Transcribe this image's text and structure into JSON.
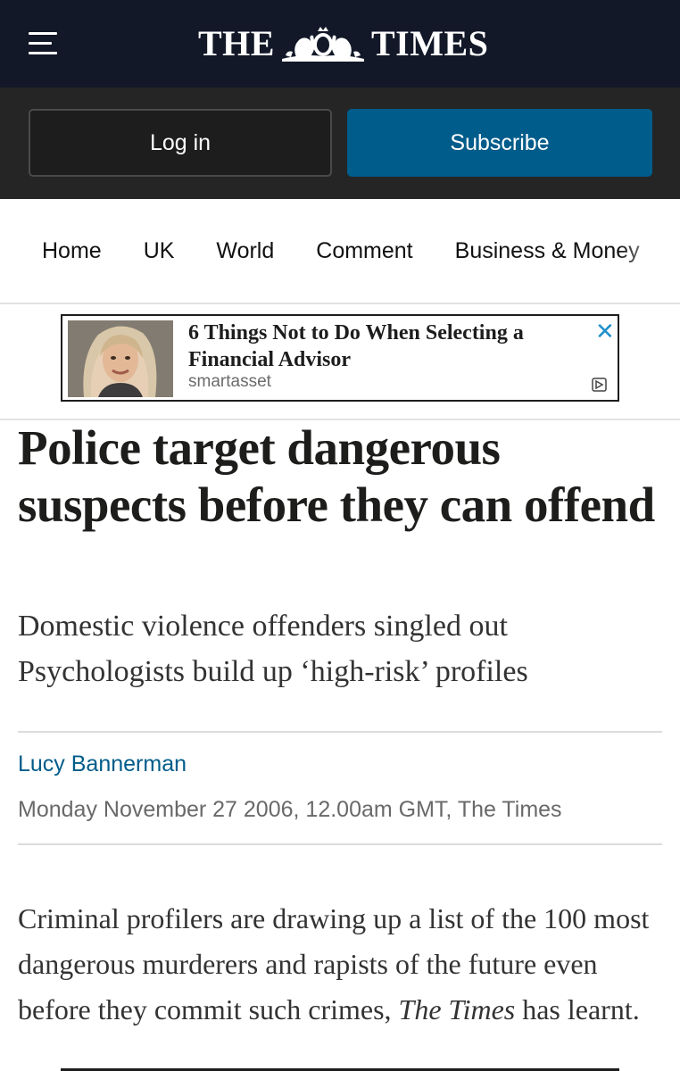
{
  "masthead": {
    "logo_left": "THE",
    "logo_right": "TIMES",
    "menu_icon": "hamburger-menu-icon",
    "crest_icon": "royal-crest-icon",
    "background": "#121828"
  },
  "auth": {
    "login_label": "Log in",
    "subscribe_label": "Subscribe",
    "subscribe_color": "#005c8a"
  },
  "nav": {
    "items": [
      {
        "label": "Home"
      },
      {
        "label": "UK"
      },
      {
        "label": "World"
      },
      {
        "label": "Comment"
      },
      {
        "label": "Business & Money"
      }
    ]
  },
  "ad": {
    "title": "6 Things Not to Do When Selecting a Financial Advisor",
    "source": "smartasset",
    "close_icon": "close-icon",
    "adchoices_icon": "adchoices-icon"
  },
  "article": {
    "headline": "Police target dangerous suspects before they can offend",
    "standfirst": [
      "Domestic violence offenders singled out",
      "Psychologists build up ‘high-risk’ profiles"
    ],
    "author": "Lucy Bannerman",
    "dateline": "Monday November 27 2006, 12.00am GMT, The Times",
    "body_lead": "Criminal profilers are drawing up a list of the 100 most dangerous murderers and rapists of the future even before they commit such crimes, ",
    "body_paper": "The Times",
    "body_tail": " has learnt.",
    "link_color": "#005c8a"
  }
}
